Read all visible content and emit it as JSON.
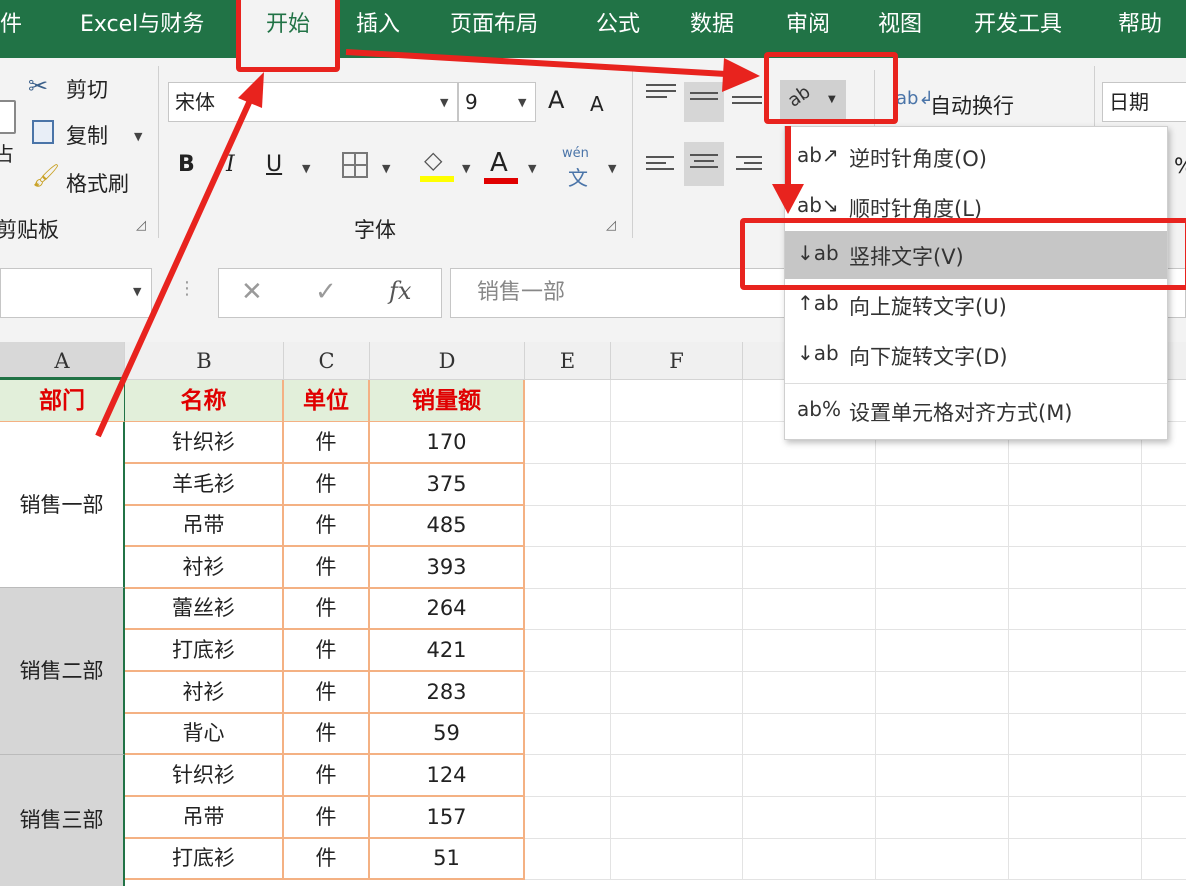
{
  "tabs": [
    {
      "label": "件"
    },
    {
      "label": "Excel与财务"
    },
    {
      "label": "开始"
    },
    {
      "label": "插入"
    },
    {
      "label": "页面布局"
    },
    {
      "label": "公式"
    },
    {
      "label": "数据"
    },
    {
      "label": "审阅"
    },
    {
      "label": "视图"
    },
    {
      "label": "开发工具"
    },
    {
      "label": "帮助"
    }
  ],
  "clipboard": {
    "cut": "剪切",
    "copy": "复制",
    "format_painter": "格式刷",
    "group_label": "剪贴板",
    "paste_fragment": "占"
  },
  "font": {
    "name": "宋体",
    "size": "9",
    "group_label": "字体",
    "grow": "A",
    "shrink": "A",
    "bold": "B",
    "italic": "I",
    "underline": "U",
    "font_color": "A",
    "phonetic": "wén"
  },
  "alignment": {
    "wrap_text": "自动换行",
    "number_format": "日期"
  },
  "orientation_menu": {
    "items": [
      {
        "label": "逆时针角度(O)",
        "icon": "ab↗"
      },
      {
        "label": "顺时针角度(L)",
        "icon": "ab↘"
      },
      {
        "label": "竖排文字(V)",
        "icon": "↓ab"
      },
      {
        "label": "向上旋转文字(U)",
        "icon": "↑ab"
      },
      {
        "label": "向下旋转文字(D)",
        "icon": "↓ab"
      },
      {
        "label": "设置单元格对齐方式(M)",
        "icon": "ab%"
      }
    ]
  },
  "formula_bar": {
    "cancel": "✕",
    "enter": "✓",
    "fx": "fx",
    "content": "销售一部"
  },
  "columns": [
    "A",
    "B",
    "C",
    "D",
    "E",
    "F"
  ],
  "table": {
    "headers": [
      "部门",
      "名称",
      "单位",
      "销量额"
    ],
    "groups": [
      "销售一部",
      "销售二部",
      "销售三部"
    ],
    "rows": [
      {
        "name": "针织衫",
        "unit": "件",
        "value": "170"
      },
      {
        "name": "羊毛衫",
        "unit": "件",
        "value": "375"
      },
      {
        "name": "吊带",
        "unit": "件",
        "value": "485"
      },
      {
        "name": "衬衫",
        "unit": "件",
        "value": "393"
      },
      {
        "name": "蕾丝衫",
        "unit": "件",
        "value": "264"
      },
      {
        "name": "打底衫",
        "unit": "件",
        "value": "421"
      },
      {
        "name": "衬衫",
        "unit": "件",
        "value": "283"
      },
      {
        "name": "背心",
        "unit": "件",
        "value": "59"
      },
      {
        "name": "针织衫",
        "unit": "件",
        "value": "124"
      },
      {
        "name": "吊带",
        "unit": "件",
        "value": "157"
      },
      {
        "name": "打底衫",
        "unit": "件",
        "value": "51"
      }
    ]
  },
  "colors": {
    "accent": "#217346",
    "annotation": "#e8231e",
    "header_fill": "#e2efda",
    "header_text": "#e00000",
    "table_border": "#f4b183"
  }
}
